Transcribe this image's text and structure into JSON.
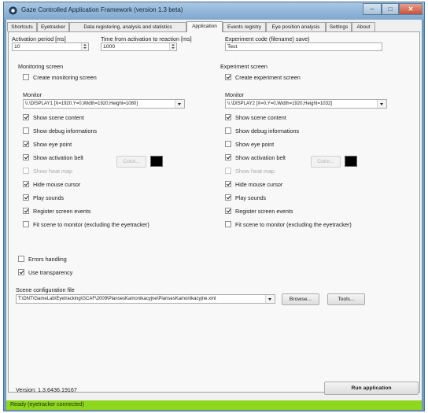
{
  "window": {
    "title": "Gaze Controlled Application Framework (version 1.3 beta)",
    "controls": [
      "–",
      "□",
      "✕"
    ]
  },
  "tabs": [
    {
      "label": "Shortcuts"
    },
    {
      "label": "Eyetracker"
    },
    {
      "label": "Data registering, analysis and statistics"
    },
    {
      "label": "Application"
    },
    {
      "label": "Events registry"
    },
    {
      "label": "Eye position analysis"
    },
    {
      "label": "Settings"
    },
    {
      "label": "About"
    }
  ],
  "top_fields": {
    "activation_label": "Activation period [ms]",
    "activation_value": "10",
    "delay_label": "Time from activation to reaction [ms]",
    "delay_value": "1000",
    "experiment_label": "Experiment code (filename) save)",
    "experiment_value": "Test"
  },
  "monitoring": {
    "section_title": "Monitoring screen",
    "create_label": "Create monitoring screen",
    "create_checked": false,
    "monitor_label": "Monitor",
    "monitor_value": "\\\\.\\DISPLAY1 [X=1920,Y=0,Width=1920,Height=1080]",
    "options": [
      {
        "label": "Show scene content",
        "checked": true,
        "enabled": true
      },
      {
        "label": "Show debug informations",
        "checked": false,
        "enabled": true
      },
      {
        "label": "Show eye point",
        "checked": true,
        "enabled": true
      },
      {
        "label": "Show activation belt",
        "checked": true,
        "enabled": true
      },
      {
        "label": "Show heat map",
        "checked": false,
        "enabled": false
      },
      {
        "label": "Hide mouse cursor",
        "checked": true,
        "enabled": true
      },
      {
        "label": "Play sounds",
        "checked": true,
        "enabled": true
      },
      {
        "label": "Register screen events",
        "checked": true,
        "enabled": true
      },
      {
        "label": "Fit scene to monitor (excluding the eyetracker)",
        "checked": false,
        "enabled": true
      }
    ],
    "color_button": "Color...",
    "swatch_color": "#000000"
  },
  "experiment": {
    "section_title": "Experiment screen",
    "create_label": "Create experiment screen",
    "create_checked": true,
    "monitor_label": "Monitor",
    "monitor_value": "\\\\.\\DISPLAY2 [X=0,Y=0,Width=1920,Height=1032]",
    "options": [
      {
        "label": "Show scene content",
        "checked": true,
        "enabled": true
      },
      {
        "label": "Show debug informations",
        "checked": false,
        "enabled": true
      },
      {
        "label": "Show eye point",
        "checked": false,
        "enabled": true
      },
      {
        "label": "Show activation belt",
        "checked": true,
        "enabled": true
      },
      {
        "label": "Show heat map",
        "checked": false,
        "enabled": false
      },
      {
        "label": "Hide mouse cursor",
        "checked": true,
        "enabled": true
      },
      {
        "label": "Play sounds",
        "checked": true,
        "enabled": true
      },
      {
        "label": "Register screen events",
        "checked": true,
        "enabled": true
      },
      {
        "label": "Fit scene to monitor (excluding the eyetracker)",
        "checked": false,
        "enabled": true
      }
    ],
    "color_button": "Color...",
    "swatch_color": "#000000"
  },
  "global_options": [
    {
      "label": "Errors handling",
      "checked": false
    },
    {
      "label": "Use transparency",
      "checked": true
    }
  ],
  "scene_config": {
    "label": "Scene configuration file",
    "value": "T:\\DNT\\GameLab\\Eyetracking\\GCAF\\2009\\PlansesKamonikacyjne\\PlansesKamonikacyjne.xml",
    "browse_button": "Browse...",
    "tools_button": "Tools..."
  },
  "footer": {
    "version": "Version: 1.3.6436.19167",
    "run_button": "Run application",
    "status": "Ready (eyetracker connected)",
    "status_color": "#8fd61e"
  }
}
